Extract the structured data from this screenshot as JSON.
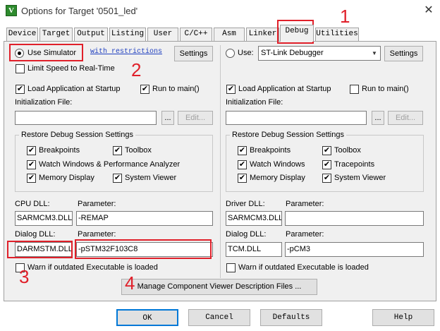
{
  "window": {
    "title": "Options for Target '0501_led'",
    "app_icon": "V",
    "close_glyph": "✕"
  },
  "tabs": [
    "Device",
    "Target",
    "Output",
    "Listing",
    "User",
    "C/C++",
    "Asm",
    "Linker",
    "Debug",
    "Utilities"
  ],
  "active_tab": "Debug",
  "left": {
    "use_simulator_label": "Use Simulator",
    "restrictions_link": "with restrictions",
    "settings_label": "Settings",
    "limit_speed_label": "Limit Speed to Real-Time",
    "load_app_label": "Load Application at Startup",
    "run_to_main_label": "Run to main()",
    "init_file_label": "Initialization File:",
    "init_file_value": "",
    "browse_label": "...",
    "edit_label": "Edit...",
    "restore_title": "Restore Debug Session Settings",
    "breakpoints_label": "Breakpoints",
    "toolbox_label": "Toolbox",
    "watch_label": "Watch Windows & Performance Analyzer",
    "memory_label": "Memory Display",
    "system_viewer_label": "System Viewer",
    "cpu_dll_label": "CPU DLL:",
    "cpu_param_label": "Parameter:",
    "cpu_dll_value": "SARMCM3.DLL",
    "cpu_param_value": "-REMAP",
    "dialog_dll_label": "Dialog DLL:",
    "dialog_param_label": "Parameter:",
    "dialog_dll_value": "DARMSTM.DLL",
    "dialog_param_value": "-pSTM32F103C8",
    "warn_label": "Warn if outdated Executable is loaded"
  },
  "right": {
    "use_label": "Use:",
    "debugger_value": "ST-Link Debugger",
    "settings_label": "Settings",
    "load_app_label": "Load Application at Startup",
    "run_to_main_label": "Run to main()",
    "init_file_label": "Initialization File:",
    "init_file_value": "",
    "browse_label": "...",
    "edit_label": "Edit...",
    "restore_title": "Restore Debug Session Settings",
    "breakpoints_label": "Breakpoints",
    "toolbox_label": "Toolbox",
    "watch_label": "Watch Windows",
    "tracepoints_label": "Tracepoints",
    "memory_label": "Memory Display",
    "system_viewer_label": "System Viewer",
    "driver_dll_label": "Driver DLL:",
    "driver_param_label": "Parameter:",
    "driver_dll_value": "SARMCM3.DLL",
    "driver_param_value": "",
    "dialog_dll_label": "Dialog DLL:",
    "dialog_param_label": "Parameter:",
    "dialog_dll_value": "TCM.DLL",
    "dialog_param_value": "-pCM3",
    "warn_label": "Warn if outdated Executable is loaded"
  },
  "manage_button_label": "Manage Component Viewer Description Files ...",
  "footer": {
    "ok": "OK",
    "cancel": "Cancel",
    "defaults": "Defaults",
    "help": "Help"
  },
  "annotations": [
    "1",
    "2",
    "3",
    "4"
  ],
  "check_glyph": "✔",
  "arrow_glyph": "▼"
}
